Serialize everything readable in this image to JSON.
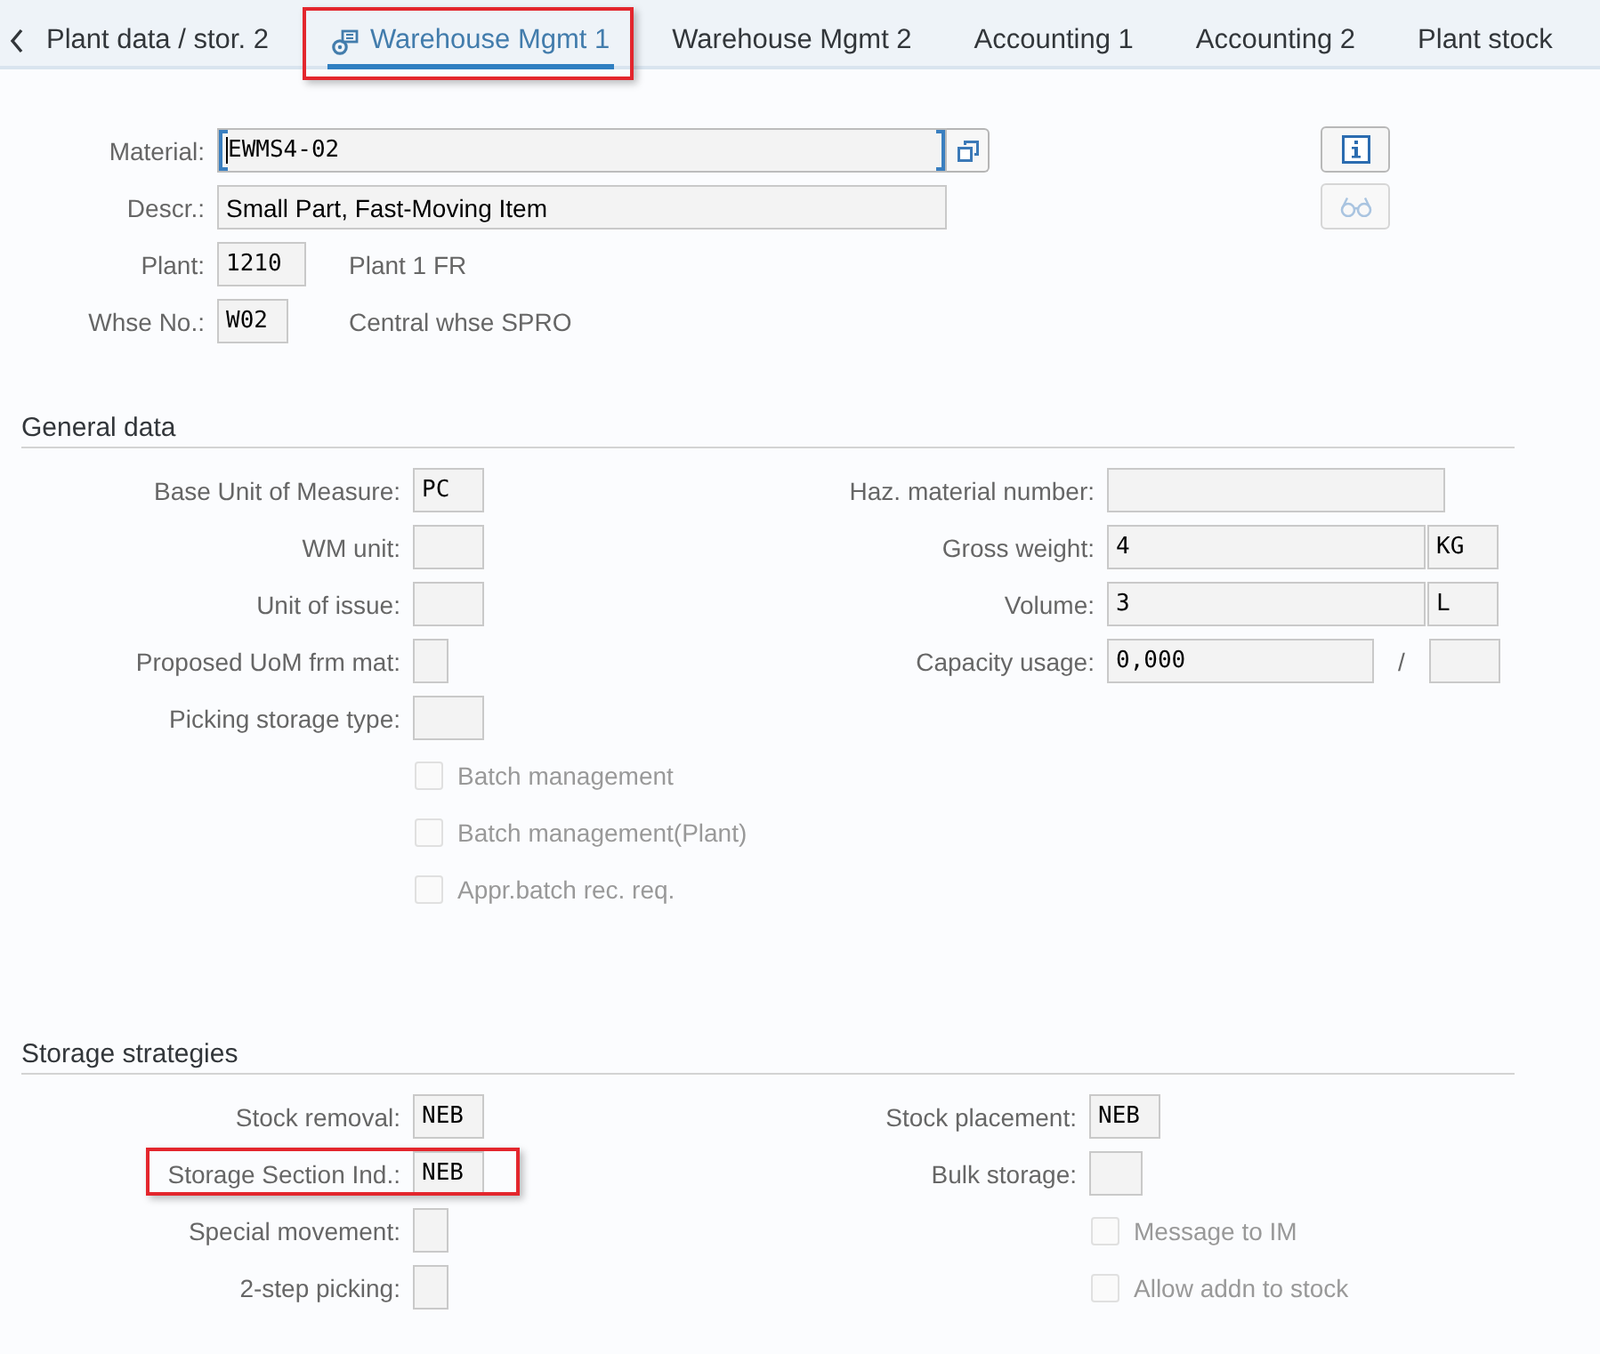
{
  "tabs": [
    {
      "label": "Plant data / stor. 2",
      "selected": false,
      "highlighted": false
    },
    {
      "label": "Warehouse Mgmt 1",
      "selected": true,
      "highlighted": true
    },
    {
      "label": "Warehouse Mgmt 2",
      "selected": false,
      "highlighted": false
    },
    {
      "label": "Accounting 1",
      "selected": false,
      "highlighted": false
    },
    {
      "label": "Accounting 2",
      "selected": false,
      "highlighted": false
    },
    {
      "label": "Plant stock",
      "selected": false,
      "highlighted": false
    }
  ],
  "header": {
    "fields": [
      {
        "kind": "key",
        "label": "Material:",
        "value": "EWMS4-02",
        "focused": true
      },
      {
        "kind": "text",
        "label": "Descr.:",
        "value": "Small Part, Fast-Moving Item",
        "focused": false
      },
      {
        "kind": "code",
        "label": "Plant:",
        "value": "1210",
        "description": "Plant 1 FR",
        "focused": false
      },
      {
        "kind": "code",
        "label": "Whse No.:",
        "value": "W02",
        "description": "Central whse SPRO",
        "focused": false
      }
    ],
    "buttons": [
      {
        "kind": "info",
        "disabled": false
      },
      {
        "kind": "display",
        "disabled": true
      }
    ]
  },
  "sections": [
    {
      "title": "General data",
      "left": [
        {
          "kind": "field",
          "label": "Base Unit of Measure:",
          "value": "PC",
          "highlighted": false
        },
        {
          "kind": "field",
          "label": "WM unit:",
          "highlighted": false
        },
        {
          "kind": "field",
          "label": "Unit of issue:",
          "highlighted": false
        },
        {
          "kind": "field",
          "label": "Proposed UoM frm mat:",
          "highlighted": false
        },
        {
          "kind": "field",
          "label": "Picking storage type:",
          "highlighted": false
        },
        {
          "kind": "checkbox",
          "label": "Batch management",
          "checked": false,
          "disabled": true,
          "highlighted": false
        },
        {
          "kind": "checkbox",
          "label": "Batch management(Plant)",
          "checked": false,
          "disabled": true,
          "highlighted": false
        },
        {
          "kind": "checkbox",
          "label": "Appr.batch rec. req.",
          "checked": false,
          "disabled": true,
          "highlighted": false
        }
      ],
      "right": [
        {
          "kind": "field",
          "label": "Haz. material number:",
          "highlighted": false
        },
        {
          "kind": "unit",
          "label": "Gross weight:",
          "value": "4",
          "unit": "KG",
          "highlighted": false
        },
        {
          "kind": "unit",
          "label": "Volume:",
          "value": "3",
          "unit": "L",
          "highlighted": false
        },
        {
          "kind": "ratio",
          "label": "Capacity usage:",
          "value": "0,000",
          "separator": "/",
          "highlighted": false
        }
      ]
    },
    {
      "title": "Storage strategies",
      "left": [
        {
          "kind": "field",
          "label": "Stock removal:",
          "value": "NEB",
          "highlighted": false
        },
        {
          "kind": "field",
          "label": "Storage Section Ind.:",
          "value": "NEB",
          "highlighted": true
        },
        {
          "kind": "field",
          "label": "Special movement:",
          "highlighted": false
        },
        {
          "kind": "field",
          "label": "2-step picking:",
          "highlighted": false
        }
      ],
      "right": [
        {
          "kind": "field",
          "label": "Stock placement:",
          "value": "NEB",
          "highlighted": false
        },
        {
          "kind": "field",
          "label": "Bulk storage:",
          "highlighted": false
        },
        {
          "kind": "checkbox",
          "label": "Message to IM",
          "checked": false,
          "disabled": true,
          "highlighted": false
        },
        {
          "kind": "checkbox",
          "label": "Allow addn to stock",
          "checked": false,
          "disabled": true,
          "highlighted": false
        }
      ]
    }
  ]
}
